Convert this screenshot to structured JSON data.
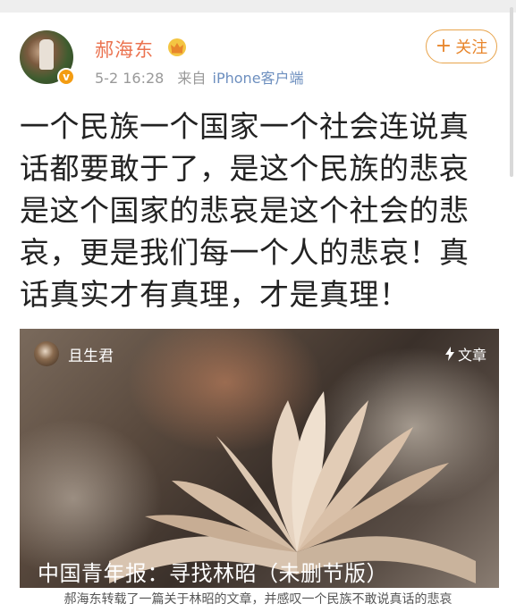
{
  "post": {
    "username": "郝海东",
    "time": "5-2 16:28",
    "source_prefix": "来自",
    "source": "iPhone客户端",
    "follow_label": "关注",
    "follow_plus": "+",
    "verified_mark": "v",
    "text": "一个民族一个国家一个社会连说真话都要敢于了，是这个民族的悲哀是这个国家的悲哀是这个社会的悲哀，更是我们每一个人的悲哀！真话真实才有真理，才是真理！"
  },
  "article_card": {
    "author": "且生君",
    "tag": "文章",
    "title": "中国青年报：寻找林昭（未删节版）"
  },
  "caption": "郝海东转载了一篇关于林昭的文章，并感叹一个民族不敢说真话的悲哀",
  "icons": {
    "avatar": "user-avatar",
    "verified": "verified-badge-icon",
    "vip": "crown-icon",
    "tag": "lightning-icon"
  },
  "colors": {
    "username": "#eb7350",
    "follow": "#e8862c",
    "meta": "#999999",
    "source": "#6d8fbf",
    "verified": "#f39c12"
  }
}
